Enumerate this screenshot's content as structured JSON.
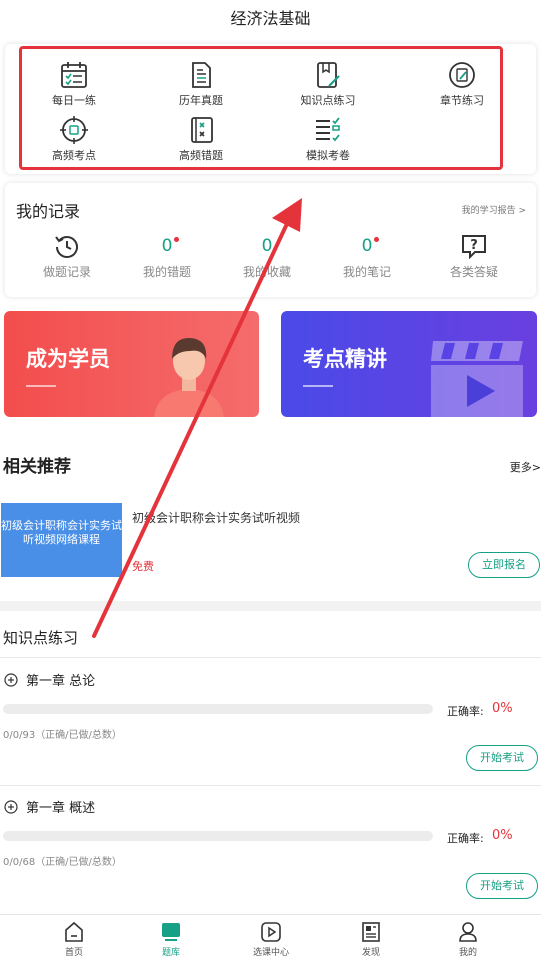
{
  "header": {
    "title": "经济法基础"
  },
  "tools": [
    {
      "label": "每日一练",
      "icon": "calendar-icon"
    },
    {
      "label": "历年真题",
      "icon": "document-icon"
    },
    {
      "label": "知识点练习",
      "icon": "book-edit-icon"
    },
    {
      "label": "章节练习",
      "icon": "edit-circle-icon"
    },
    {
      "label": "高频考点",
      "icon": "target-icon"
    },
    {
      "label": "高频错题",
      "icon": "error-book-icon"
    },
    {
      "label": "模拟考卷",
      "icon": "checklist-icon"
    }
  ],
  "records": {
    "title": "我的记录",
    "report_link": "我的学习报告 >",
    "items": [
      {
        "label": "做题记录",
        "icon": "history-icon"
      },
      {
        "label": "我的错题",
        "count": "0"
      },
      {
        "label": "我的收藏",
        "count": "0"
      },
      {
        "label": "我的笔记",
        "count": "0"
      },
      {
        "label": "各类答疑",
        "icon": "question-icon"
      }
    ]
  },
  "banners": [
    {
      "label": "成为学员",
      "color": "#f34d4d"
    },
    {
      "label": "考点精讲",
      "color": "#4a4ae8"
    }
  ],
  "recommend": {
    "title": "相关推荐",
    "more": "更多>",
    "course": {
      "thumb_text": "初级会计职称会计实务试听视频网络课程",
      "title": "初级会计职称会计实务试听视频",
      "price": "免费",
      "enroll_label": "立即报名"
    }
  },
  "practice": {
    "title": "知识点练习",
    "chapters": [
      {
        "name": "第一章 总论",
        "rate_label": "正确率:",
        "rate": "0%",
        "progress": 0,
        "stats": "0/0/93（正确/已做/总数）",
        "button": "开始考试"
      },
      {
        "name": "第一章 概述",
        "rate_label": "正确率:",
        "rate": "0%",
        "progress": 0,
        "stats": "0/0/68（正确/已做/总数）",
        "button": "开始考试"
      }
    ]
  },
  "tabs": [
    {
      "label": "首页",
      "icon": "home-icon"
    },
    {
      "label": "题库",
      "icon": "question-bank-icon",
      "active": true
    },
    {
      "label": "选课中心",
      "icon": "play-icon"
    },
    {
      "label": "发现",
      "icon": "news-icon"
    },
    {
      "label": "我的",
      "icon": "user-icon"
    }
  ],
  "colors": {
    "accent": "#16a085",
    "alert": "#e5333b",
    "annotation": "#e5333b"
  }
}
